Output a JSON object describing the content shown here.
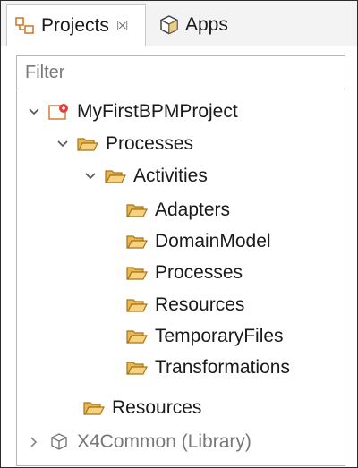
{
  "tabs": {
    "projects": {
      "label": "Projects",
      "icon": "projects-view-icon",
      "close": "☒"
    },
    "apps": {
      "label": "Apps",
      "icon": "apps-cube-icon"
    }
  },
  "filter": {
    "placeholder": "Filter",
    "value": ""
  },
  "tree": {
    "project": {
      "label": "MyFirstBPMProject",
      "icon": "bpm-project-icon",
      "expanded": true
    },
    "processes": {
      "label": "Processes",
      "expanded": true
    },
    "activities": {
      "label": "Activities",
      "expanded": true
    },
    "activity_children": [
      {
        "label": "Adapters"
      },
      {
        "label": "DomainModel"
      },
      {
        "label": "Processes"
      },
      {
        "label": "Resources"
      },
      {
        "label": "TemporaryFiles"
      },
      {
        "label": "Transformations"
      }
    ],
    "resources": {
      "label": "Resources"
    },
    "library": {
      "label": "X4Common (Library)",
      "icon": "library-cube-icon",
      "expanded": false
    }
  },
  "colors": {
    "folder_fill": "#f3c667",
    "folder_stroke": "#b27d1c",
    "project_accent": "#e0413b",
    "library_text": "#777777"
  }
}
